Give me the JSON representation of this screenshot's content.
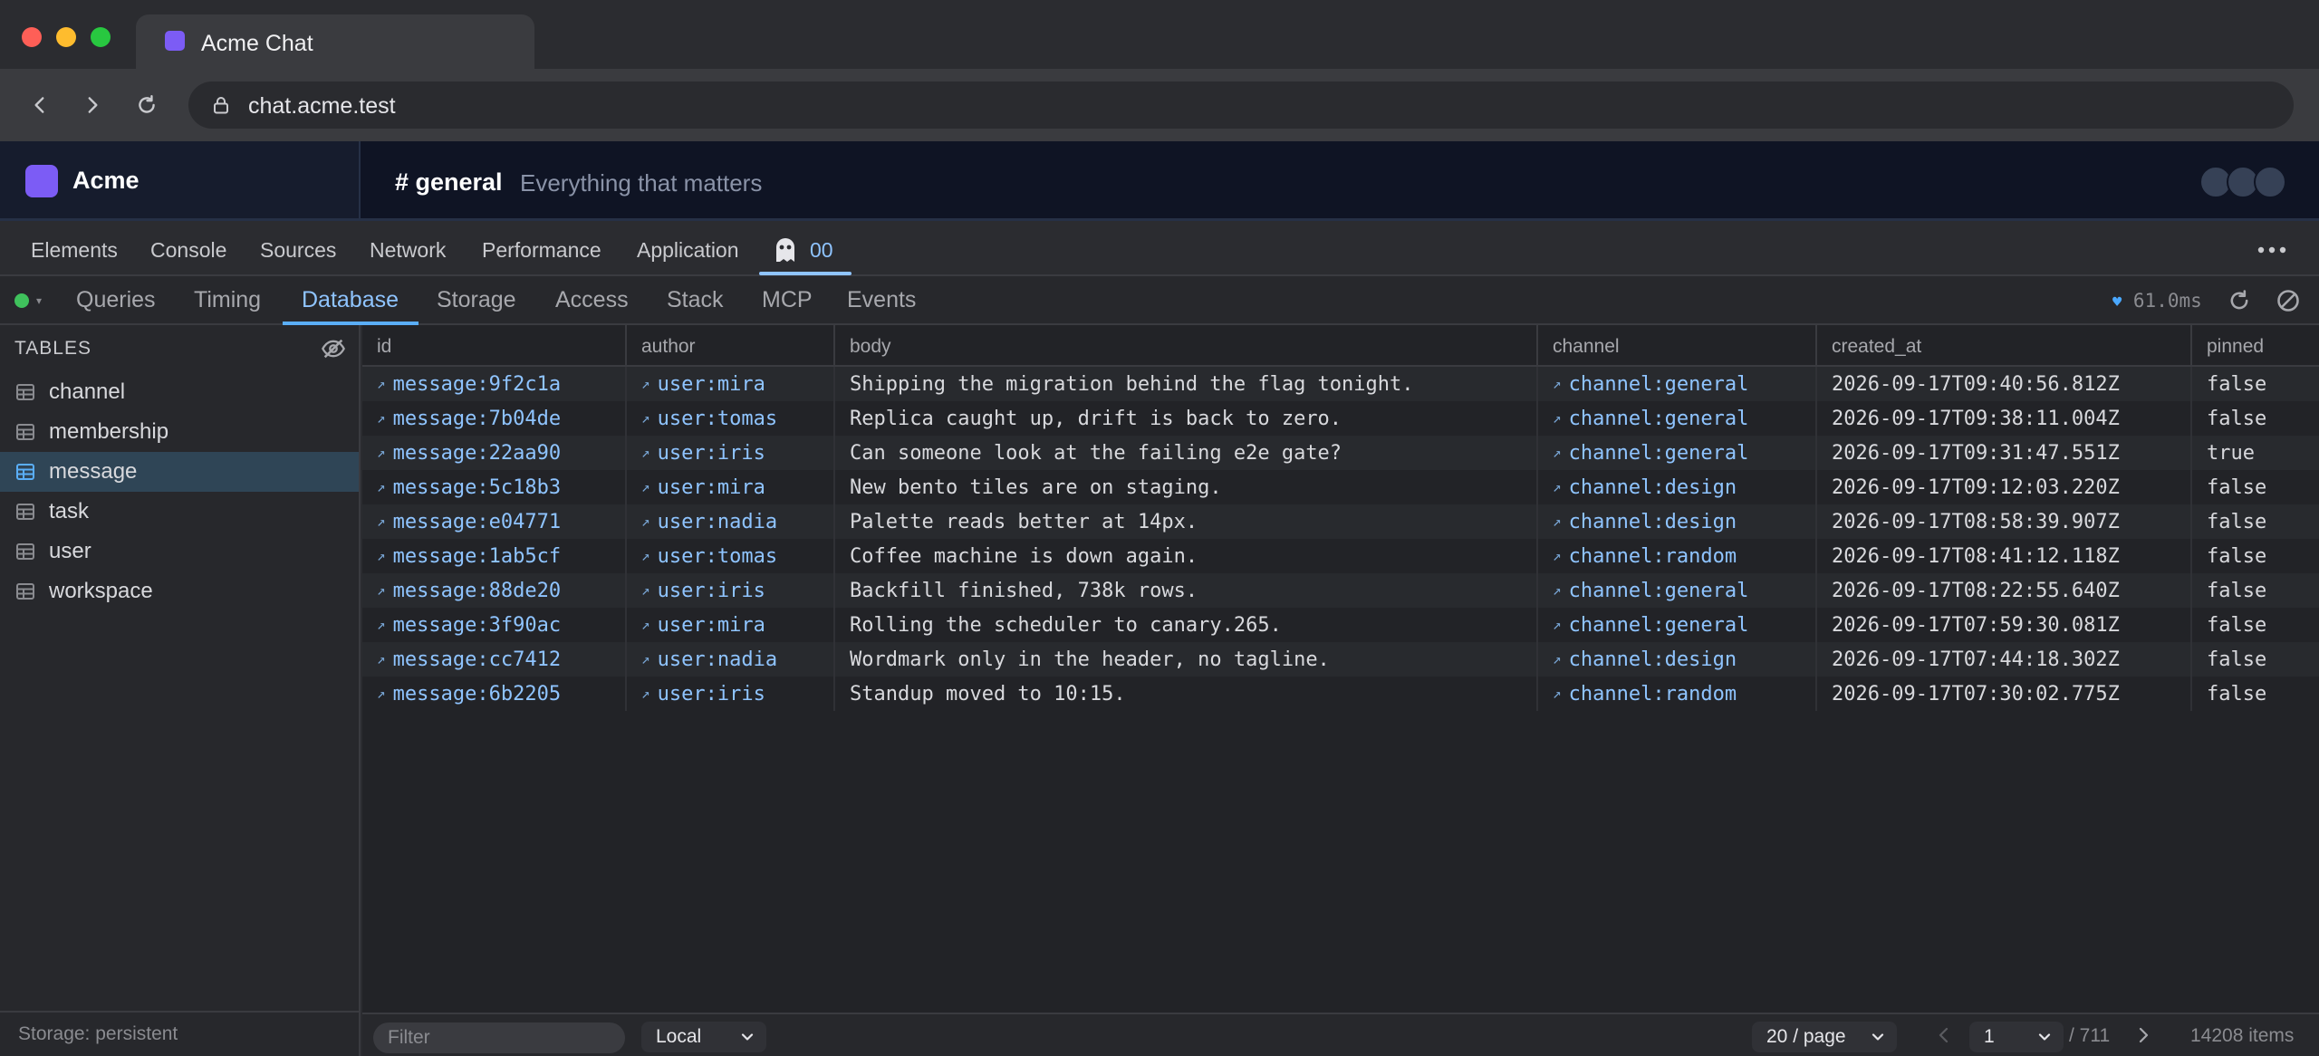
{
  "browser": {
    "tab_title": "Acme Chat",
    "url": "chat.acme.test"
  },
  "app": {
    "brand": "Acme",
    "channel": "# general",
    "channel_description": "Everything that matters",
    "colors": {
      "accent": "#7c5cf5",
      "link": "#8fc4ff",
      "status_ok": "#3fc15c"
    }
  },
  "devtools": {
    "tabs": [
      "Elements",
      "Console",
      "Sources",
      "Network",
      "Performance",
      "Application"
    ],
    "extension_tab": "00",
    "extension_icon": "ghost-icon"
  },
  "subtabs": {
    "items": [
      "Queries",
      "Timing",
      "Database",
      "Storage",
      "Access",
      "Stack",
      "MCP",
      "Events"
    ],
    "active": "Database",
    "timing": "61.0ms"
  },
  "sidebar": {
    "heading": "TABLES",
    "tables": [
      "channel",
      "membership",
      "message",
      "task",
      "user",
      "workspace"
    ],
    "active": "message",
    "storage": "Storage: persistent"
  },
  "table": {
    "columns": [
      "id",
      "author",
      "body",
      "channel",
      "created_at",
      "pinned"
    ],
    "rows": [
      [
        "message:9f2c1a",
        "user:mira",
        "Shipping the migration behind the flag tonight.",
        "channel:general",
        "2026-09-17T09:40:56.812Z",
        "false"
      ],
      [
        "message:7b04de",
        "user:tomas",
        "Replica caught up, drift is back to zero.",
        "channel:general",
        "2026-09-17T09:38:11.004Z",
        "false"
      ],
      [
        "message:22aa90",
        "user:iris",
        "Can someone look at the failing e2e gate?",
        "channel:general",
        "2026-09-17T09:31:47.551Z",
        "true"
      ],
      [
        "message:5c18b3",
        "user:mira",
        "New bento tiles are on staging.",
        "channel:design",
        "2026-09-17T09:12:03.220Z",
        "false"
      ],
      [
        "message:e04771",
        "user:nadia",
        "Palette reads better at 14px.",
        "channel:design",
        "2026-09-17T08:58:39.907Z",
        "false"
      ],
      [
        "message:1ab5cf",
        "user:tomas",
        "Coffee machine is down again.",
        "channel:random",
        "2026-09-17T08:41:12.118Z",
        "false"
      ],
      [
        "message:88de20",
        "user:iris",
        "Backfill finished, 738k rows.",
        "channel:general",
        "2026-09-17T08:22:55.640Z",
        "false"
      ],
      [
        "message:3f90ac",
        "user:mira",
        "Rolling the scheduler to canary.265.",
        "channel:general",
        "2026-09-17T07:59:30.081Z",
        "false"
      ],
      [
        "message:cc7412",
        "user:nadia",
        "Wordmark only in the header, no tagline.",
        "channel:design",
        "2026-09-17T07:44:18.302Z",
        "false"
      ],
      [
        "message:6b2205",
        "user:iris",
        "Standup moved to 10:15.",
        "channel:random",
        "2026-09-17T07:30:02.775Z",
        "false"
      ]
    ]
  },
  "footer": {
    "filter_placeholder": "Filter",
    "scope": "Local",
    "page_size": "20 / page",
    "page": "1",
    "page_total": "/ 711",
    "items": "14208 items"
  }
}
